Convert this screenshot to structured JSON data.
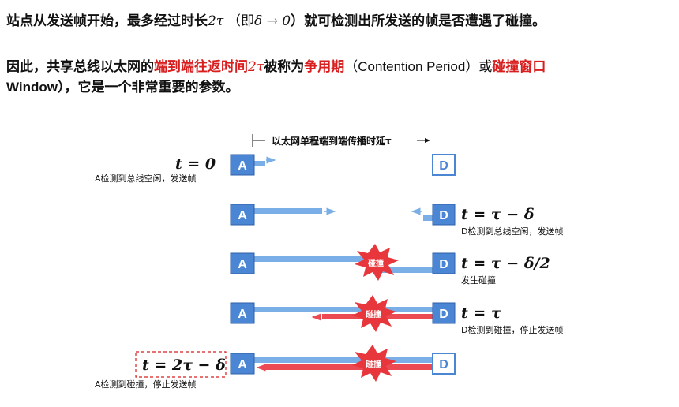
{
  "paragraph1": {
    "before": "站点从发送帧开始，最多经过时长",
    "math1": "2τ",
    "paren_open": "（即",
    "math2": "δ → 0",
    "after": "）就可检测出所发送的帧是否遭遇了碰撞。"
  },
  "paragraph2": {
    "line1_before": "因此，共享总线以太网的",
    "highlight1": "端到端往返时间",
    "highlight1_math": "2τ",
    "mid": "被称为",
    "highlight2": "争用期",
    "paren": "（Contention Period）或",
    "highlight3": "碰撞窗口",
    "line2": "Window），它是一个非常重要的参数。"
  },
  "diagram": {
    "top_label": "以太网单程端到端传播时延τ",
    "station_a": "A",
    "station_d": "D",
    "collision_label": "碰撞",
    "rows": [
      {
        "left_eq": "t = 0",
        "left_caption": "A检测到总线空闲，发送帧"
      },
      {
        "right_eq": "t = τ − δ",
        "right_caption": "D检测到总线空闲，发送帧"
      },
      {
        "right_eq": "t = τ − δ/2",
        "right_caption": "发生碰撞"
      },
      {
        "right_eq": "t = τ",
        "right_caption": "D检测到碰撞，停止发送帧"
      },
      {
        "left_eq": "t = 2τ − δ",
        "left_caption": "A检测到碰撞，停止发送帧"
      }
    ]
  },
  "colors": {
    "station_fill": "#4a86d4",
    "blue_signal": "#7aaee6",
    "red_signal": "#ec4a52",
    "highlight_text": "#d81e1e",
    "collision_fill": "#e8373c"
  }
}
